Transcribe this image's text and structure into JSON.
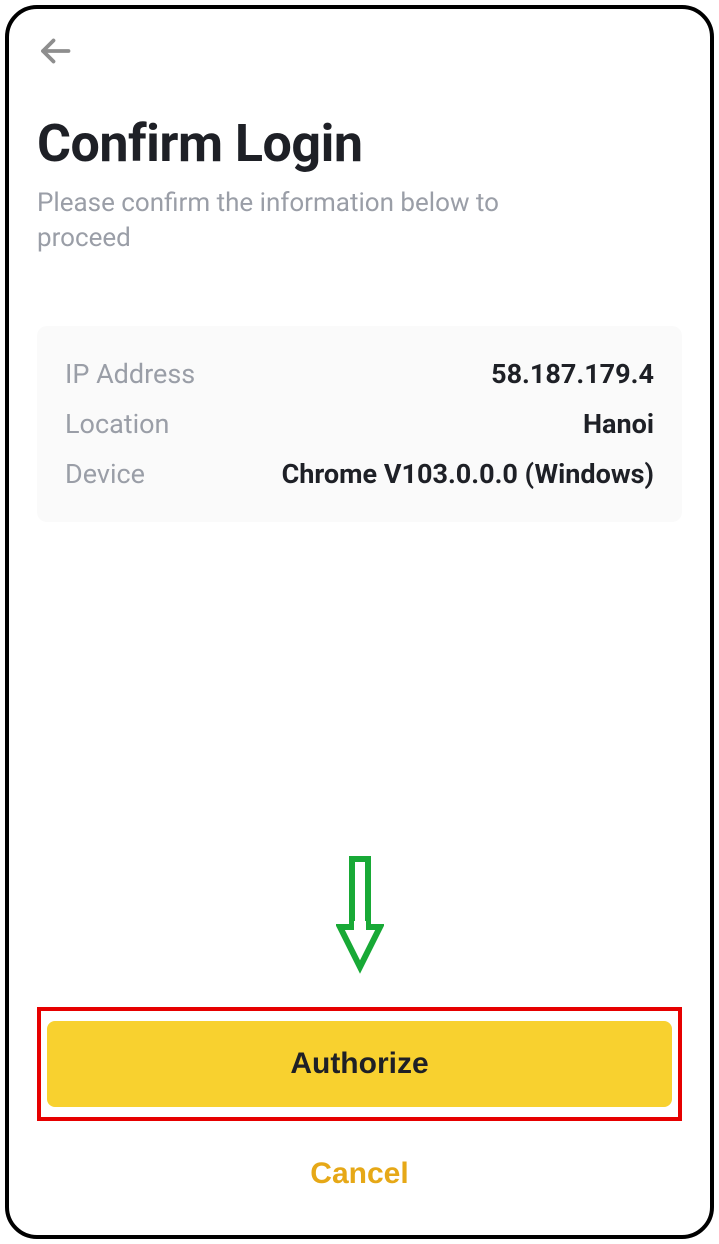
{
  "header": {
    "title": "Confirm Login",
    "subtitle": "Please confirm the information below to proceed"
  },
  "info": {
    "ip_label": "IP Address",
    "ip_value": "58.187.179.4",
    "location_label": "Location",
    "location_value": "Hanoi",
    "device_label": "Device",
    "device_value": "Chrome V103.0.0.0 (Windows)"
  },
  "actions": {
    "authorize_label": "Authorize",
    "cancel_label": "Cancel"
  }
}
